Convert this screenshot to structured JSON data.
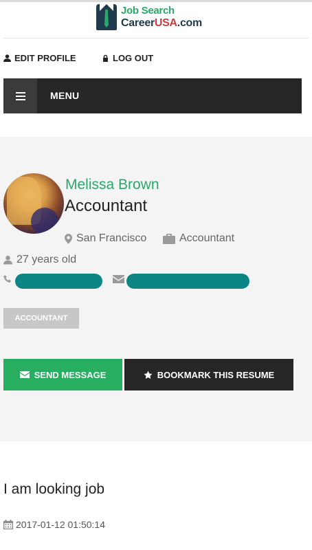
{
  "header": {
    "logo": {
      "line1": "Job Search",
      "line2_prefix": "Career",
      "line2_highlight": "USA",
      "line2_suffix": ".com"
    }
  },
  "toplinks": {
    "edit_profile": "EDIT PROFILE",
    "log_out": "LOG OUT"
  },
  "menu": {
    "label": "MENU"
  },
  "profile": {
    "name": "Melissa Brown",
    "title": "Accountant",
    "location": "San Francisco",
    "category": "Accountant",
    "age": "27 years old",
    "tag": "ACCOUNTANT"
  },
  "actions": {
    "send_message": "SEND MESSAGE",
    "bookmark": "BOOKMARK THIS RESUME"
  },
  "details": {
    "looking_for": "I am looking job",
    "posted_at": "2017-01-12 01:50:14"
  },
  "colors": {
    "accent_green": "#27ae60",
    "dark": "#262626",
    "redaction": "#0e8585"
  },
  "icons": [
    "user-icon",
    "lock-icon",
    "menu-icon",
    "map-marker-icon",
    "briefcase-icon",
    "phone-icon",
    "envelope-icon",
    "star-icon",
    "calendar-icon"
  ]
}
